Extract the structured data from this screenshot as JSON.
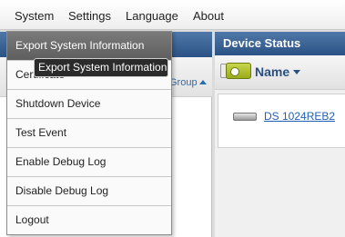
{
  "menubar": {
    "items": [
      "System",
      "Settings",
      "Language",
      "About"
    ]
  },
  "system_menu": {
    "items": [
      "Export System Information",
      "Certificate",
      "Shutdown Device",
      "Test Event",
      "Enable Debug Log",
      "Disable Debug Log",
      "Logout"
    ],
    "tooltip": "Export System Information"
  },
  "left_panel": {
    "group_sort_label": "Group"
  },
  "device_status": {
    "title": "Device Status",
    "column_name": "Name",
    "devices": [
      "DS 1024REB2"
    ]
  },
  "colors": {
    "header_blue": "#2b5284",
    "link_blue": "#1f5fb5",
    "menu_active": "#6b6b6b"
  }
}
